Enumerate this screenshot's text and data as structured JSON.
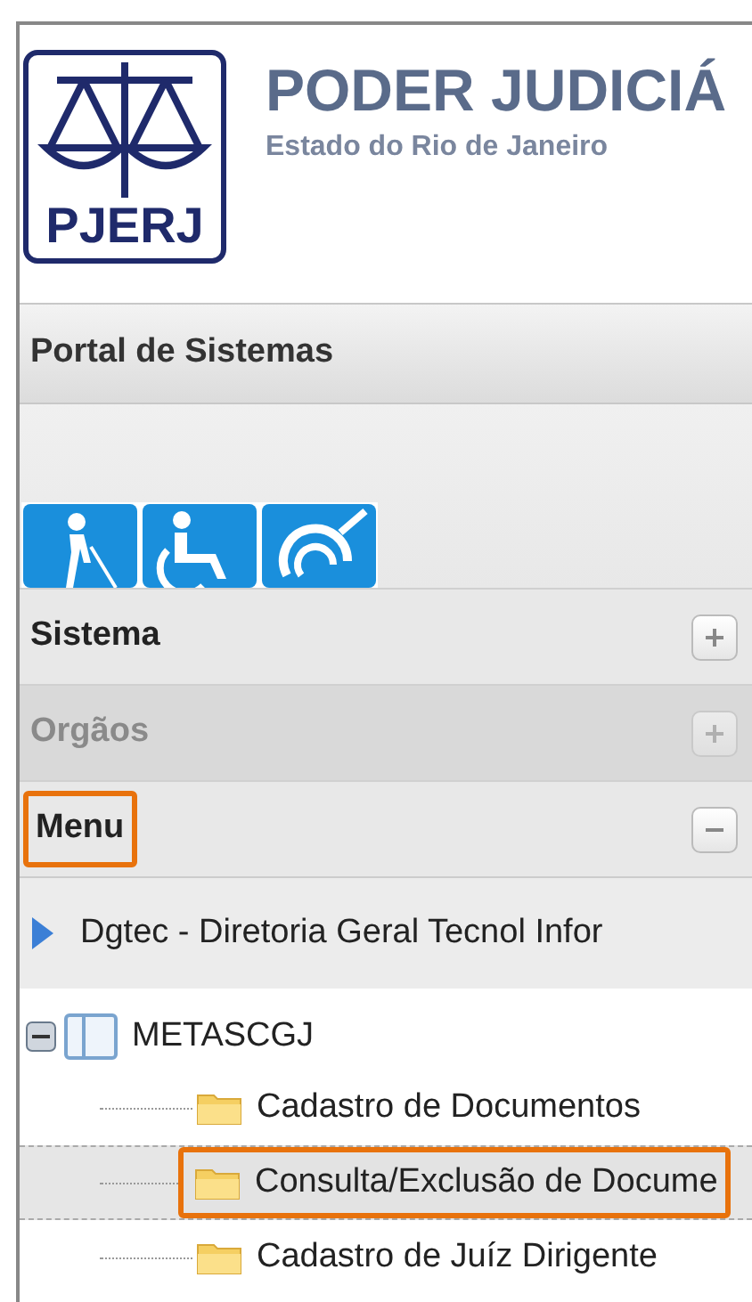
{
  "header": {
    "logo_text": "PJERJ",
    "title": "PODER JUDICIÁ",
    "subtitle": "Estado do Rio de Janeiro"
  },
  "portal_title": "Portal de Sistemas",
  "sections": [
    {
      "label": "Sistema",
      "expanded": false,
      "disabled": false,
      "highlighted": false
    },
    {
      "label": "Orgãos",
      "expanded": false,
      "disabled": true,
      "highlighted": false
    },
    {
      "label": "Menu",
      "expanded": true,
      "disabled": false,
      "highlighted": true
    }
  ],
  "menu_link": "Dgtec - Diretoria Geral Tecnol Infor",
  "tree": {
    "label": "METASCGJ",
    "expanded": true,
    "children": [
      {
        "label": "Cadastro de Documentos",
        "selected": false,
        "highlighted": false
      },
      {
        "label": "Consulta/Exclusão de Docume",
        "selected": true,
        "highlighted": true
      },
      {
        "label": "Cadastro de Juíz Dirigente",
        "selected": false,
        "highlighted": false
      }
    ]
  }
}
